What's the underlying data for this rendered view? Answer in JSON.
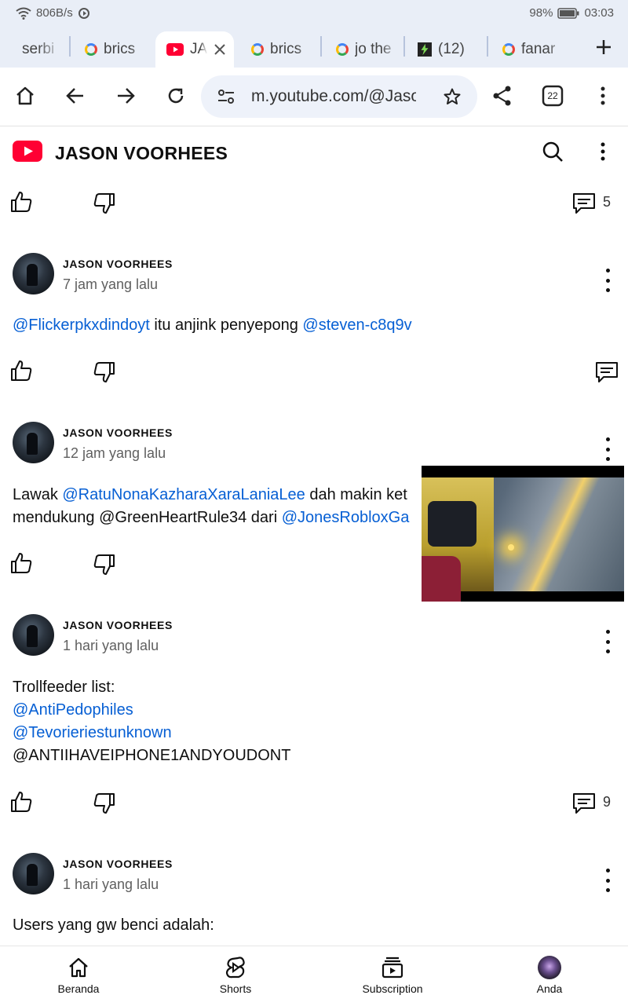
{
  "status": {
    "net_speed": "806B/s",
    "battery": "98%",
    "time": "03:03"
  },
  "tabs": [
    {
      "label": "serbi",
      "icon": "google-icon"
    },
    {
      "label": "brics",
      "icon": "google-icon"
    },
    {
      "label": "JA",
      "icon": "youtube-icon",
      "active": true
    },
    {
      "label": "brics",
      "icon": "google-icon"
    },
    {
      "label": "jo the",
      "icon": "google-icon"
    },
    {
      "label": "(12)",
      "icon": "site-icon"
    },
    {
      "label": "fanar",
      "icon": "google-icon"
    }
  ],
  "toolbar": {
    "url": "m.youtube.com/@Jaso",
    "tab_count": "22"
  },
  "header": {
    "channel_name": "JASON VOORHEES"
  },
  "top_actions": {
    "comment_count": "5"
  },
  "posts": [
    {
      "author": "JASON VOORHEES",
      "time": "7 jam yang lalu",
      "lines": [
        [
          {
            "t": "@Flickerpkxdindoyt",
            "m": true
          },
          {
            "t": " itu anjink penyepong "
          },
          {
            "t": "@steven-c8q9v",
            "m": true
          }
        ]
      ],
      "comment_count": ""
    },
    {
      "author": "JASON VOORHEES",
      "time": "12 jam yang lalu",
      "lines": [
        [
          {
            "t": "Lawak "
          },
          {
            "t": "@RatuNonaKazharaXaraLaniaLee",
            "m": true
          },
          {
            "t": " dah makin ket"
          }
        ],
        [
          {
            "t": "mendukung @GreenHeartRule34 dari "
          },
          {
            "t": "@JonesRobloxGa",
            "m": true
          }
        ]
      ],
      "comment_count": ""
    },
    {
      "author": "JASON VOORHEES",
      "time": "1 hari yang lalu",
      "lines": [
        [
          {
            "t": "Trollfeeder list:"
          }
        ],
        [
          {
            "t": "@AntiPedophiles",
            "m": true
          }
        ],
        [
          {
            "t": "@Tevorieriestunknown",
            "m": true
          }
        ],
        [
          {
            "t": "@ANTIIHAVEIPHONE1ANDYOUDONT"
          }
        ]
      ],
      "comment_count": "9"
    },
    {
      "author": "JASON VOORHEES",
      "time": "1 hari yang lalu",
      "lines": [
        [
          {
            "t": "Users yang gw benci adalah:"
          }
        ]
      ],
      "comment_count": ""
    }
  ],
  "bottom_nav": [
    {
      "label": "Beranda",
      "icon": "home-icon"
    },
    {
      "label": "Shorts",
      "icon": "shorts-icon"
    },
    {
      "label": "Subscription",
      "icon": "subscriptions-icon"
    },
    {
      "label": "Anda",
      "icon": "avatar"
    }
  ]
}
